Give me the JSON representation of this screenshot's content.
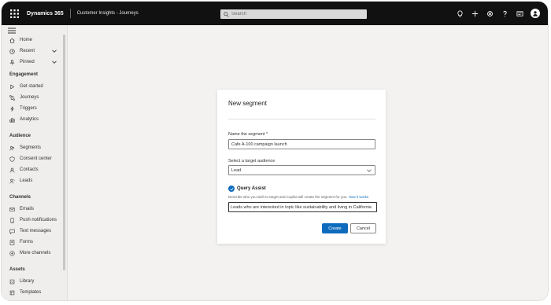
{
  "header": {
    "app_name": "Dynamics 365",
    "area_name": "Customer Insights - Journeys",
    "search_placeholder": "Search",
    "icons": [
      "lightbulb-icon",
      "add-icon",
      "settings-icon",
      "help-icon",
      "feedback-icon",
      "avatar"
    ]
  },
  "sidebar": {
    "top_items": [
      {
        "label": "Home",
        "icon": "home-icon"
      },
      {
        "label": "Recent",
        "icon": "clock-icon"
      },
      {
        "label": "Pinned",
        "icon": "pin-icon"
      }
    ],
    "sections": [
      {
        "title": "Engagement",
        "items": [
          {
            "label": "Get started",
            "icon": "play-icon"
          },
          {
            "label": "Journeys",
            "icon": "journey-icon"
          },
          {
            "label": "Triggers",
            "icon": "trigger-icon"
          },
          {
            "label": "Analytics",
            "icon": "analytics-icon"
          }
        ]
      },
      {
        "title": "Audience",
        "items": [
          {
            "label": "Segments",
            "icon": "segments-icon"
          },
          {
            "label": "Consent center",
            "icon": "consent-icon"
          },
          {
            "label": "Contacts",
            "icon": "contact-icon"
          },
          {
            "label": "Leads",
            "icon": "leads-icon"
          }
        ]
      },
      {
        "title": "Channels",
        "items": [
          {
            "label": "Emails",
            "icon": "mail-icon"
          },
          {
            "label": "Push notifications",
            "icon": "push-icon"
          },
          {
            "label": "Text messages",
            "icon": "sms-icon"
          },
          {
            "label": "Forms",
            "icon": "form-icon"
          },
          {
            "label": "More channels",
            "icon": "more-channels-icon"
          }
        ]
      },
      {
        "title": "Assets",
        "items": [
          {
            "label": "Library",
            "icon": "library-icon"
          },
          {
            "label": "Templates",
            "icon": "template-icon"
          }
        ]
      }
    ]
  },
  "dialog": {
    "title": "New segment",
    "name_label": "Name the segment *",
    "name_value": "Cafe A-100 campaign launch",
    "audience_label": "Select a target audience",
    "audience_value": "Lead",
    "query_assist_title": "Query Assist",
    "query_assist_desc": "Describe who you wish to target and Copilot will create the segment for you.",
    "query_assist_link": "How it works",
    "query_value": "Leads who are interested in topic like sustainability and living in California",
    "create_label": "Create",
    "cancel_label": "Cancel"
  },
  "colors": {
    "topbar": "#111111",
    "accent": "#0f6cbd",
    "canvas": "#f3f2f1"
  }
}
